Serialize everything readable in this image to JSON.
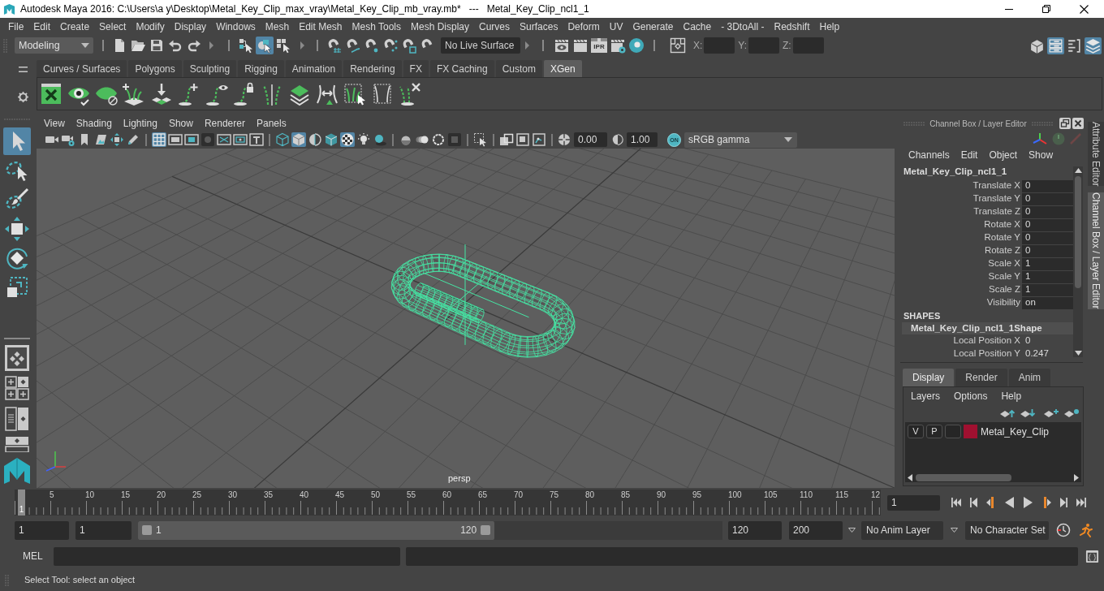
{
  "window": {
    "title": "Autodesk Maya 2016: C:\\Users\\a y\\Desktop\\Metal_Key_Clip_max_vray\\Metal_Key_Clip_mb_vray.mb*   ---   Metal_Key_Clip_ncl1_1"
  },
  "menu_bar": [
    "File",
    "Edit",
    "Create",
    "Select",
    "Modify",
    "Display",
    "Windows",
    "Mesh",
    "Edit Mesh",
    "Mesh Tools",
    "Mesh Display",
    "Curves",
    "Surfaces",
    "Deform",
    "UV",
    "Generate",
    "Cache",
    "- 3DtoAll -",
    "Redshift",
    "Help"
  ],
  "status_line": {
    "workspace": "Modeling",
    "select_modes": [
      {
        "kind": "hierarchy",
        "selected": false
      },
      {
        "kind": "object",
        "selected": true
      },
      {
        "kind": "component",
        "selected": false
      }
    ],
    "live_surface": "No Live Surface",
    "ipr_label": "IPR",
    "coordinates": [
      "X:",
      "Y:",
      "Z:"
    ],
    "panel_toggles": [
      {
        "kind": "modeling_toolkit",
        "selected": false
      },
      {
        "kind": "attribute_editor",
        "selected": true
      },
      {
        "kind": "tool_settings",
        "selected": false
      },
      {
        "kind": "channel_box",
        "selected": true
      }
    ]
  },
  "shelf_tabs": [
    {
      "label": "Curves / Surfaces",
      "selected": false
    },
    {
      "label": "Polygons",
      "selected": false
    },
    {
      "label": "Sculpting",
      "selected": false
    },
    {
      "label": "Rigging",
      "selected": false
    },
    {
      "label": "Animation",
      "selected": false
    },
    {
      "label": "Rendering",
      "selected": false
    },
    {
      "label": "FX",
      "selected": false
    },
    {
      "label": "FX Caching",
      "selected": false
    },
    {
      "label": "Custom",
      "selected": false
    },
    {
      "label": "XGen",
      "selected": true
    }
  ],
  "toolbox": [
    {
      "kind": "select",
      "selected": true
    },
    {
      "kind": "lasso",
      "selected": false
    },
    {
      "kind": "paint",
      "selected": false
    },
    {
      "kind": "move",
      "selected": false
    },
    {
      "kind": "rotate",
      "selected": false
    },
    {
      "kind": "scale",
      "selected": false
    }
  ],
  "viewport": {
    "menu": [
      "View",
      "Shading",
      "Lighting",
      "Show",
      "Renderer",
      "Panels"
    ],
    "toolbar": [
      [
        {
          "kind": "camera",
          "selected": false
        },
        {
          "kind": "camera_attributes",
          "selected": false
        },
        {
          "kind": "bookmark",
          "selected": false
        },
        {
          "kind": "image_plane",
          "selected": false
        },
        {
          "kind": "pan_zoom",
          "selected": false
        },
        {
          "kind": "grease_pencil",
          "selected": false
        }
      ],
      [
        {
          "kind": "grid",
          "selected": true
        },
        {
          "kind": "film_gate",
          "selected": false
        },
        {
          "kind": "resolution_gate",
          "selected": false
        },
        {
          "kind": "gate_mask",
          "selected": false
        },
        {
          "kind": "field_chart",
          "selected": false
        },
        {
          "kind": "safe_action",
          "selected": false
        },
        {
          "kind": "safe_title",
          "selected": false
        }
      ],
      [
        {
          "kind": "wireframe",
          "selected": false
        },
        {
          "kind": "smooth_shade",
          "selected": true
        },
        {
          "kind": "wireframe_on_shaded",
          "selected": false
        },
        {
          "kind": "xray_shaded",
          "selected": false
        },
        {
          "kind": "textured",
          "selected": true
        },
        {
          "kind": "lights",
          "selected": false
        },
        {
          "kind": "shadows",
          "selected": false
        }
      ],
      [
        {
          "kind": "ambient_occlusion",
          "selected": false
        },
        {
          "kind": "motion_blur",
          "selected": false
        },
        {
          "kind": "anti_aliasing",
          "selected": false
        },
        {
          "kind": "depth_of_field",
          "selected": false
        }
      ],
      [
        {
          "kind": "isolate_select",
          "selected": false
        }
      ],
      [
        {
          "kind": "xray",
          "selected": false
        },
        {
          "kind": "xray_active",
          "selected": false
        },
        {
          "kind": "xray_joints",
          "selected": false
        }
      ]
    ],
    "exposure": "0.00",
    "gamma": "1.00",
    "view_transform": {
      "label": "ON",
      "on": true
    },
    "color_space": "sRGB gamma",
    "camera": "persp"
  },
  "channel_box": {
    "title": "Channel Box / Layer Editor",
    "menu": [
      "Channels",
      "Edit",
      "Object",
      "Show"
    ],
    "object": "Metal_Key_Clip_ncl1_1",
    "attributes": [
      {
        "label": "Translate X",
        "value": "0"
      },
      {
        "label": "Translate Y",
        "value": "0"
      },
      {
        "label": "Translate Z",
        "value": "0"
      },
      {
        "label": "Rotate X",
        "value": "0"
      },
      {
        "label": "Rotate Y",
        "value": "0"
      },
      {
        "label": "Rotate Z",
        "value": "0"
      },
      {
        "label": "Scale X",
        "value": "1"
      },
      {
        "label": "Scale Y",
        "value": "1"
      },
      {
        "label": "Scale Z",
        "value": "1"
      },
      {
        "label": "Visibility",
        "value": "on"
      }
    ],
    "shapes_heading": "SHAPES",
    "shape": "Metal_Key_Clip_ncl1_1Shape",
    "shape_attributes": [
      {
        "label": "Local Position X",
        "value": "0"
      },
      {
        "label": "Local Position Y",
        "value": "0.247"
      }
    ]
  },
  "layer_editor": {
    "tabs": [
      {
        "label": "Display",
        "selected": true
      },
      {
        "label": "Render",
        "selected": false
      },
      {
        "label": "Anim",
        "selected": false
      }
    ],
    "menu": [
      "Layers",
      "Options",
      "Help"
    ],
    "layers": [
      {
        "visibility": "V",
        "playback": "P",
        "color": "#a01030",
        "name": "Metal_Key_Clip"
      }
    ]
  },
  "side_tabs": [
    {
      "label": "Attribute Editor",
      "selected": false
    },
    {
      "label": "Channel Box / Layer Editor",
      "selected": true
    }
  ],
  "time_slider": {
    "labels": [
      "5",
      "10",
      "15",
      "20",
      "25",
      "30",
      "35",
      "40",
      "45",
      "50",
      "55",
      "60",
      "65",
      "70",
      "75",
      "80",
      "85",
      "90",
      "95",
      "100",
      "105",
      "110",
      "115",
      "12"
    ],
    "current_frame": "1",
    "frame_field": "1"
  },
  "range_slider": {
    "start": "1",
    "playback_start": "1",
    "level": 0.61,
    "range_start": "1",
    "range_end": "120",
    "playback_end": "120",
    "end": "200",
    "anim_layer": "No Anim Layer",
    "character_set": "No Character Set"
  },
  "command_line": {
    "language": "MEL"
  },
  "help_line": "Select Tool: select an object"
}
